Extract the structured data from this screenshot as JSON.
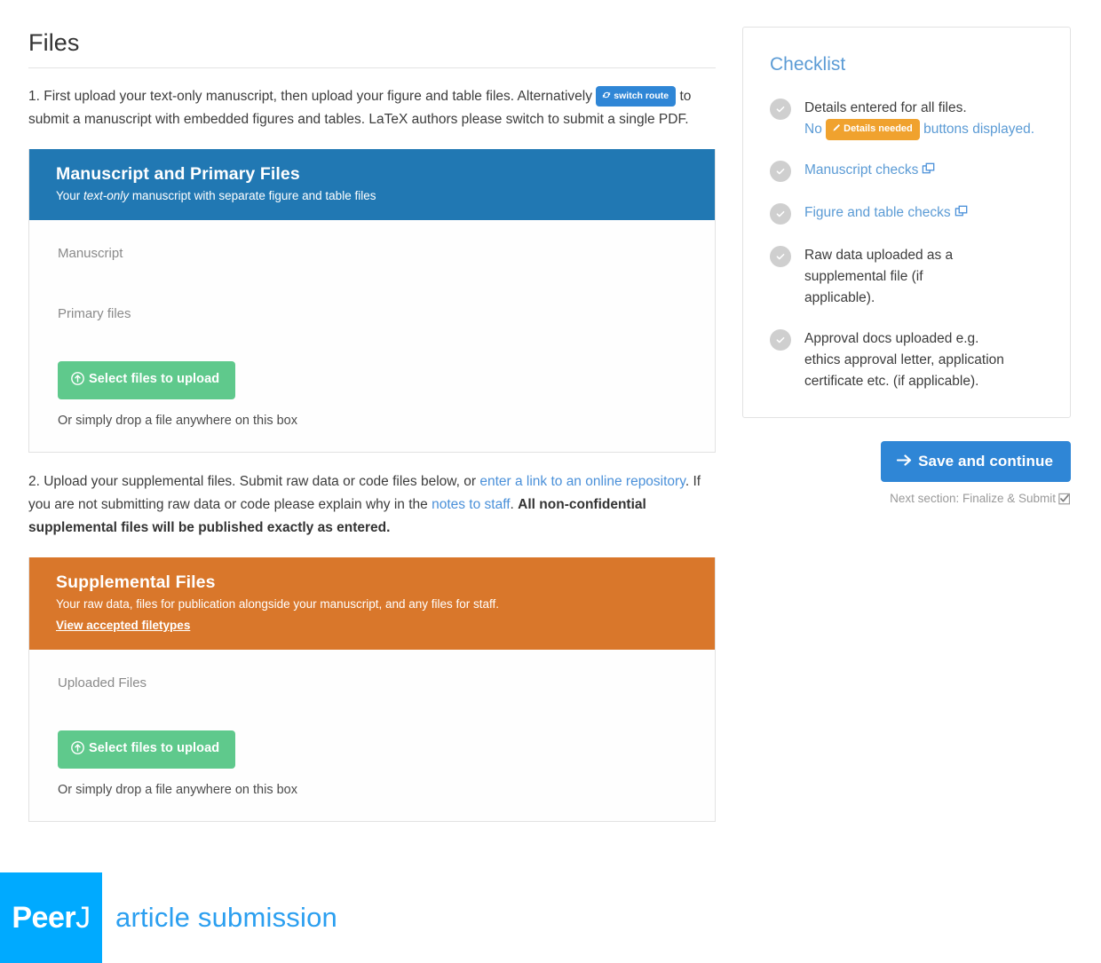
{
  "page": {
    "title": "Files"
  },
  "instructions": {
    "step1": {
      "part1": "1. First upload your text-only manuscript, then upload your figure and table files. Alternatively ",
      "badge_label": "switch route",
      "badge_icon": "refresh-icon",
      "part2": " to submit a manuscript with embedded figures and tables. LaTeX authors please switch to submit a single PDF."
    },
    "step2": {
      "part1": "2. Upload your supplemental files. Submit raw data or code files below, or ",
      "link1": "enter a link to an online repository",
      "part2": ". If you are not submitting raw data or code please explain why in the ",
      "link2": "notes to staff",
      "part3": ". ",
      "bold": "All non-confidential supplemental files will be published exactly as entered."
    }
  },
  "manuscript_panel": {
    "heading": "Manuscript and Primary Files",
    "subtitle_pre": "Your ",
    "subtitle_em": "text-only",
    "subtitle_post": " manuscript with separate figure and table files",
    "slot1_label": "Manuscript",
    "slot2_label": "Primary files",
    "upload_button": "Select files to upload",
    "upload_icon": "upload-circle-icon",
    "drop_hint": "Or simply drop a file anywhere on this box",
    "header_color": "#2178b3"
  },
  "supplemental_panel": {
    "heading": "Supplemental Files",
    "subtitle": "Your raw data, files for publication alongside your manuscript, and any files for staff.",
    "filetypes_link": "View accepted filetypes",
    "slot1_label": "Uploaded Files",
    "upload_button": "Select files to upload",
    "upload_icon": "upload-circle-icon",
    "drop_hint": "Or simply drop a file anywhere on this box",
    "header_color": "#d9772b"
  },
  "checklist": {
    "title": "Checklist",
    "items": [
      {
        "icon": "check-circle-icon",
        "text_pre": "Details entered for all files.",
        "text_line2_pre": "No ",
        "badge_label": "Details needed",
        "badge_icon": "pencil-icon",
        "text_line2_post": " buttons displayed.",
        "is_link": false
      },
      {
        "icon": "check-circle-icon",
        "label": "Manuscript checks",
        "trailing_icon": "external-window-icon",
        "is_link": true
      },
      {
        "icon": "check-circle-icon",
        "label": "Figure and table checks",
        "trailing_icon": "external-window-icon",
        "is_link": true
      },
      {
        "icon": "check-circle-icon",
        "label": "Raw data uploaded as a supplemental file (if applicable).",
        "is_link": false
      },
      {
        "icon": "check-circle-icon",
        "label": "Approval docs uploaded e.g. ethics approval letter, application certificate etc. (if applicable).",
        "is_link": false
      }
    ]
  },
  "actions": {
    "save_label": "Save and continue",
    "save_icon": "arrow-right-icon",
    "next_section": "Next section: Finalize & Submit",
    "next_section_icon": "checkbox-checked-icon",
    "save_color": "#2f86d6"
  },
  "footer": {
    "logo_peer": "Peer",
    "logo_j": "J",
    "tagline": "article submission",
    "logo_bg": "#00aaff",
    "tagline_color": "#2b9ff0"
  }
}
